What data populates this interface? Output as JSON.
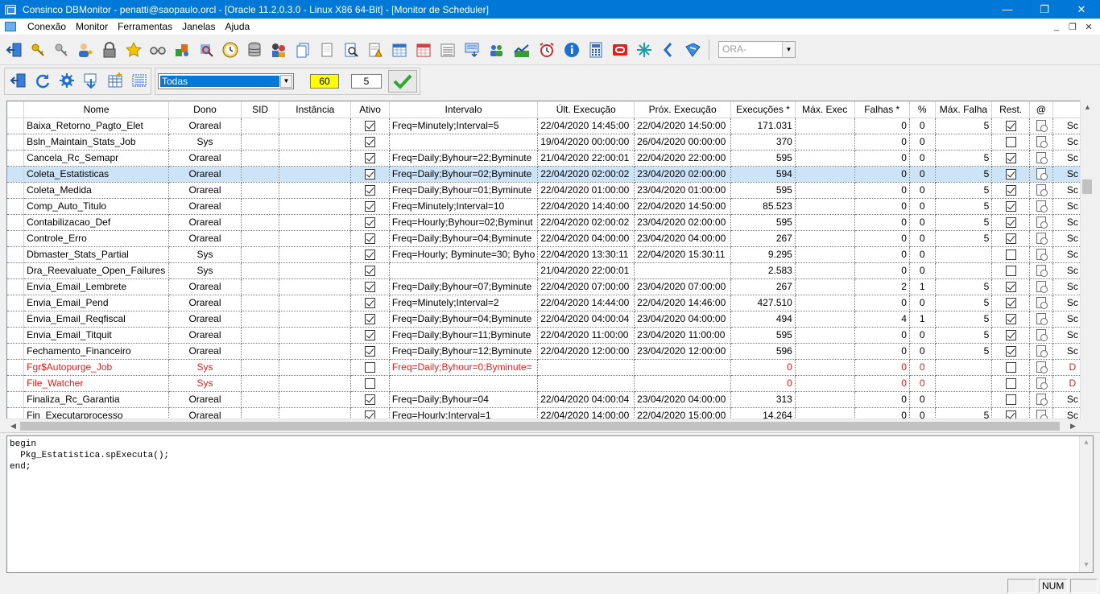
{
  "window": {
    "title": "Consinco DBMonitor - penatti@saopaulo.orcl - [Oracle 11.2.0.3.0 - Linux X86 64-Bit] - [Monitor de Scheduler]",
    "controls": {
      "minimize": "—",
      "restore": "❐",
      "close": "✕"
    }
  },
  "menu": {
    "items": [
      "Conexão",
      "Monitor",
      "Ferramentas",
      "Janelas",
      "Ajuda"
    ],
    "mdi_controls": {
      "minimize": "_",
      "restore": "❐",
      "close": "✕"
    }
  },
  "toolbar": {
    "connection_combo": "ORA-"
  },
  "filters": {
    "owner_filter": "Todas",
    "refresh_interval": "60",
    "count": "5",
    "apply_icon": "checkmark-icon"
  },
  "grid": {
    "columns": [
      "",
      "Nome",
      "Dono",
      "SID",
      "Instância",
      "Ativo",
      "Intervalo",
      "Últ. Execução",
      "Próx. Execução",
      "Execuções *",
      "Máx. Exec",
      "Falhas *",
      "%",
      "Máx. Falha",
      "Rest.",
      "@",
      ""
    ],
    "rows": [
      {
        "nome": "Baixa_Retorno_Pagto_Elet",
        "dono": "Orareal",
        "sid": "",
        "instancia": "",
        "ativo": true,
        "intervalo": "Freq=Minutely;Interval=5",
        "ult": "22/04/2020 14:45:00",
        "prox": "22/04/2020 14:50:00",
        "execucoes": "171.031",
        "max_exec": "",
        "falhas": "0",
        "pct": "0",
        "max_falha": "5",
        "rest": true,
        "extra": "Sc",
        "status": "normal"
      },
      {
        "nome": "Bsln_Maintain_Stats_Job",
        "dono": "Sys",
        "sid": "",
        "instancia": "",
        "ativo": true,
        "intervalo": "",
        "ult": "19/04/2020 00:00:00",
        "prox": "26/04/2020 00:00:00",
        "execucoes": "370",
        "max_exec": "",
        "falhas": "0",
        "pct": "0",
        "max_falha": "",
        "rest": false,
        "extra": "Sc",
        "status": "normal"
      },
      {
        "nome": "Cancela_Rc_Semapr",
        "dono": "Orareal",
        "sid": "",
        "instancia": "",
        "ativo": true,
        "intervalo": "Freq=Daily;Byhour=22;Byminute",
        "ult": "21/04/2020 22:00:01",
        "prox": "22/04/2020 22:00:00",
        "execucoes": "595",
        "max_exec": "",
        "falhas": "0",
        "pct": "0",
        "max_falha": "5",
        "rest": true,
        "extra": "Sc",
        "status": "normal"
      },
      {
        "nome": "Coleta_Estatisticas",
        "dono": "Orareal",
        "sid": "",
        "instancia": "",
        "ativo": true,
        "intervalo": "Freq=Daily;Byhour=02;Byminute",
        "ult": "22/04/2020 02:00:02",
        "prox": "23/04/2020 02:00:00",
        "execucoes": "594",
        "max_exec": "",
        "falhas": "0",
        "pct": "0",
        "max_falha": "5",
        "rest": true,
        "extra": "Sc",
        "status": "selected"
      },
      {
        "nome": "Coleta_Medida",
        "dono": "Orareal",
        "sid": "",
        "instancia": "",
        "ativo": true,
        "intervalo": "Freq=Daily;Byhour=01;Byminute",
        "ult": "22/04/2020 01:00:00",
        "prox": "23/04/2020 01:00:00",
        "execucoes": "595",
        "max_exec": "",
        "falhas": "0",
        "pct": "0",
        "max_falha": "5",
        "rest": true,
        "extra": "Sc",
        "status": "normal"
      },
      {
        "nome": "Comp_Auto_Titulo",
        "dono": "Orareal",
        "sid": "",
        "instancia": "",
        "ativo": true,
        "intervalo": "Freq=Minutely;Interval=10",
        "ult": "22/04/2020 14:40:00",
        "prox": "22/04/2020 14:50:00",
        "execucoes": "85.523",
        "max_exec": "",
        "falhas": "0",
        "pct": "0",
        "max_falha": "5",
        "rest": true,
        "extra": "Sc",
        "status": "normal"
      },
      {
        "nome": "Contabilizacao_Def",
        "dono": "Orareal",
        "sid": "",
        "instancia": "",
        "ativo": true,
        "intervalo": "Freq=Hourly;Byhour=02;Byminut",
        "ult": "22/04/2020 02:00:02",
        "prox": "23/04/2020 02:00:00",
        "execucoes": "595",
        "max_exec": "",
        "falhas": "0",
        "pct": "0",
        "max_falha": "5",
        "rest": true,
        "extra": "Sc",
        "status": "normal"
      },
      {
        "nome": "Controle_Erro",
        "dono": "Orareal",
        "sid": "",
        "instancia": "",
        "ativo": true,
        "intervalo": "Freq=Daily;Byhour=04;Byminute",
        "ult": "22/04/2020 04:00:00",
        "prox": "23/04/2020 04:00:00",
        "execucoes": "267",
        "max_exec": "",
        "falhas": "0",
        "pct": "0",
        "max_falha": "5",
        "rest": true,
        "extra": "Sc",
        "status": "normal"
      },
      {
        "nome": "Dbmaster_Stats_Partial",
        "dono": "Sys",
        "sid": "",
        "instancia": "",
        "ativo": true,
        "intervalo": "Freq=Hourly; Byminute=30; Byho",
        "ult": "22/04/2020 13:30:11",
        "prox": "22/04/2020 15:30:11",
        "execucoes": "9.295",
        "max_exec": "",
        "falhas": "0",
        "pct": "0",
        "max_falha": "",
        "rest": false,
        "extra": "Sc",
        "status": "normal"
      },
      {
        "nome": "Dra_Reevaluate_Open_Failures",
        "dono": "Sys",
        "sid": "",
        "instancia": "",
        "ativo": true,
        "intervalo": "",
        "ult": "21/04/2020 22:00:01",
        "prox": "",
        "execucoes": "2.583",
        "max_exec": "",
        "falhas": "0",
        "pct": "0",
        "max_falha": "",
        "rest": false,
        "extra": "Sc",
        "status": "normal"
      },
      {
        "nome": "Envia_Email_Lembrete",
        "dono": "Orareal",
        "sid": "",
        "instancia": "",
        "ativo": true,
        "intervalo": "Freq=Daily;Byhour=07;Byminute",
        "ult": "22/04/2020 07:00:00",
        "prox": "23/04/2020 07:00:00",
        "execucoes": "267",
        "max_exec": "",
        "falhas": "2",
        "pct": "1",
        "max_falha": "5",
        "rest": true,
        "extra": "Sc",
        "status": "normal"
      },
      {
        "nome": "Envia_Email_Pend",
        "dono": "Orareal",
        "sid": "",
        "instancia": "",
        "ativo": true,
        "intervalo": "Freq=Minutely;Interval=2",
        "ult": "22/04/2020 14:44:00",
        "prox": "22/04/2020 14:46:00",
        "execucoes": "427.510",
        "max_exec": "",
        "falhas": "0",
        "pct": "0",
        "max_falha": "5",
        "rest": true,
        "extra": "Sc",
        "status": "normal"
      },
      {
        "nome": "Envia_Email_Reqfiscal",
        "dono": "Orareal",
        "sid": "",
        "instancia": "",
        "ativo": true,
        "intervalo": "Freq=Daily;Byhour=04;Byminute",
        "ult": "22/04/2020 04:00:04",
        "prox": "23/04/2020 04:00:00",
        "execucoes": "494",
        "max_exec": "",
        "falhas": "4",
        "pct": "1",
        "max_falha": "5",
        "rest": true,
        "extra": "Sc",
        "status": "normal"
      },
      {
        "nome": "Envia_Email_Titquit",
        "dono": "Orareal",
        "sid": "",
        "instancia": "",
        "ativo": true,
        "intervalo": "Freq=Daily;Byhour=11;Byminute",
        "ult": "22/04/2020 11:00:00",
        "prox": "23/04/2020 11:00:00",
        "execucoes": "595",
        "max_exec": "",
        "falhas": "0",
        "pct": "0",
        "max_falha": "5",
        "rest": true,
        "extra": "Sc",
        "status": "normal"
      },
      {
        "nome": "Fechamento_Financeiro",
        "dono": "Orareal",
        "sid": "",
        "instancia": "",
        "ativo": true,
        "intervalo": "Freq=Daily;Byhour=12;Byminute",
        "ult": "22/04/2020 12:00:00",
        "prox": "23/04/2020 12:00:00",
        "execucoes": "596",
        "max_exec": "",
        "falhas": "0",
        "pct": "0",
        "max_falha": "5",
        "rest": true,
        "extra": "Sc",
        "status": "normal"
      },
      {
        "nome": "Fgr$Autopurge_Job",
        "dono": "Sys",
        "sid": "",
        "instancia": "",
        "ativo": false,
        "intervalo": "Freq=Daily;Byhour=0;Byminute=",
        "ult": "",
        "prox": "",
        "execucoes": "0",
        "max_exec": "",
        "falhas": "0",
        "pct": "0",
        "max_falha": "",
        "rest": false,
        "extra": "D",
        "status": "error"
      },
      {
        "nome": "File_Watcher",
        "dono": "Sys",
        "sid": "",
        "instancia": "",
        "ativo": false,
        "intervalo": "",
        "ult": "",
        "prox": "",
        "execucoes": "0",
        "max_exec": "",
        "falhas": "0",
        "pct": "0",
        "max_falha": "",
        "rest": false,
        "extra": "D",
        "status": "error"
      },
      {
        "nome": "Finaliza_Rc_Garantia",
        "dono": "Orareal",
        "sid": "",
        "instancia": "",
        "ativo": true,
        "intervalo": "Freq=Daily;Byhour=04",
        "ult": "22/04/2020 04:00:04",
        "prox": "23/04/2020 04:00:00",
        "execucoes": "313",
        "max_exec": "",
        "falhas": "0",
        "pct": "0",
        "max_falha": "",
        "rest": false,
        "extra": "Sc",
        "status": "normal"
      },
      {
        "nome": "Fin_Executarprocesso",
        "dono": "Orareal",
        "sid": "",
        "instancia": "",
        "ativo": true,
        "intervalo": "Freq=Hourly;Interval=1",
        "ult": "22/04/2020 14:00:00",
        "prox": "22/04/2020 15:00:00",
        "execucoes": "14.264",
        "max_exec": "",
        "falhas": "0",
        "pct": "0",
        "max_falha": "5",
        "rest": true,
        "extra": "Sc",
        "status": "normal"
      }
    ]
  },
  "code": {
    "text": "begin\n  Pkg_Estatistica.spExecuta();\nend;"
  },
  "statusbar": {
    "num": "NUM"
  },
  "colors": {
    "titlebar": "#0078d7",
    "selection": "#cde3f7",
    "error_text": "#e02020",
    "interval_highlight": "#ffff00"
  }
}
